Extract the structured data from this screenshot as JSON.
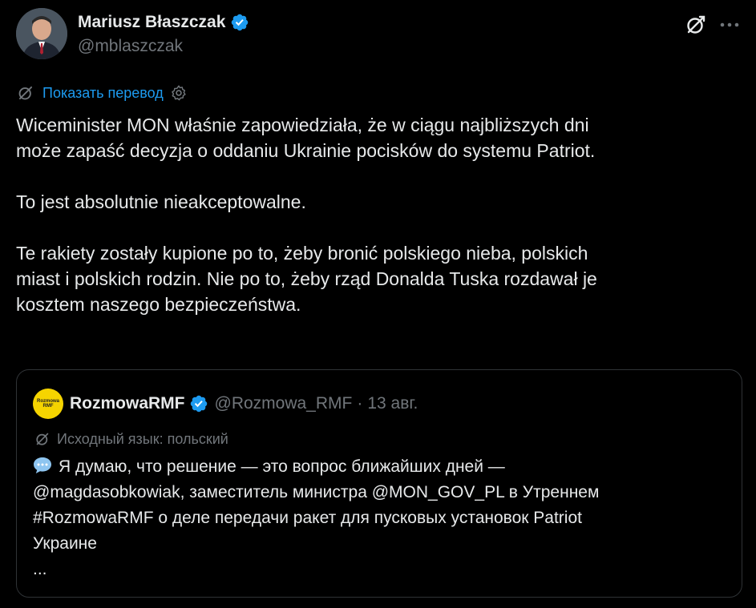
{
  "author": {
    "name": "Mariusz Błaszczak",
    "handle": "@mblaszczak",
    "verified": true,
    "verified_color": "#1d9bf0"
  },
  "header_actions": {
    "grok_icon": "grok-icon",
    "more_icon": "more-icon"
  },
  "translate": {
    "link_label": "Показать перевод"
  },
  "tweet": {
    "text": "Wiceminister MON właśnie zapowiedziała, że w ciągu najbliższych dni\nmoże zapaść decyzja o oddaniu Ukrainie pocisków do systemu Patriot.\n\nTo jest absolutnie nieakceptowalne.\n\nTe rakiety zostały kupione po to, żeby bronić polskiego nieba, polskich\nmiast i polskich rodzin. Nie po to, żeby rząd Donalda Tuska rozdawał je\nkosztem naszego bezpieczeństwa."
  },
  "quote": {
    "avatar_text": "Rozmowa RMF",
    "name": "RozmowaRMF",
    "handle": "@Rozmowa_RMF",
    "separator": "·",
    "date": "13 авг.",
    "source_language": "Исходный язык: польский",
    "lines": [
      "Я думаю, что решение — это вопрос ближайших дней —",
      "@magdasobkowiak, заместитель министра @MON_GOV_PL в Утреннем",
      "#RozmowaRMF о деле передачи ракет для пусковых установок Patriot",
      "Украине",
      "..."
    ]
  },
  "colors": {
    "background": "#000000",
    "text": "#e7e9ea",
    "secondary": "#71767b",
    "accent": "#1d9bf0",
    "border": "#2f3336",
    "rmf_yellow": "#f5d400"
  }
}
